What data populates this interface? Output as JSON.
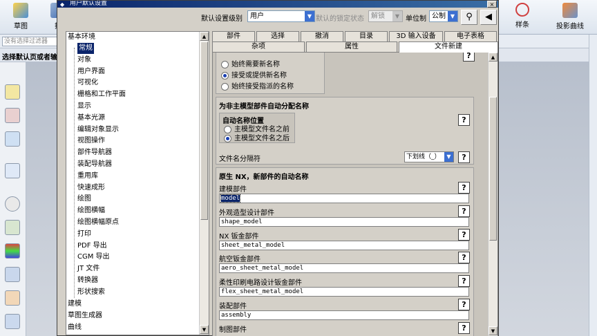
{
  "app": {
    "ribbon": {
      "sketch_label": "草图",
      "pull_label": "拉",
      "spline_label": "样条",
      "projected_curve_label": "投影曲线"
    },
    "filter_placeholder": "没有选择过滤器",
    "prompt": "选择默认页或者输"
  },
  "dialog": {
    "title": "用户默认设置",
    "close_glyph": "×",
    "topbar": {
      "level_label": "默认设置级别",
      "level_value": "用户",
      "lock_label": "默认的锁定状态",
      "lock_value": "解锁",
      "unit_label": "单位制",
      "unit_value": "公制"
    },
    "tree": {
      "root_basic": "基本环境",
      "items": [
        "常规",
        "对象",
        "用户界面",
        "可视化",
        "栅格和工作平面",
        "显示",
        "基本光源",
        "编辑对象显示",
        "视图操作",
        "部件导航器",
        "装配导航器",
        "重用库",
        "快速成形",
        "绘图",
        "绘图横幅",
        "绘图横幅原点",
        "打印",
        "PDF 导出",
        "CGM 导出",
        "JT 文件",
        "转换器",
        "形状搜索"
      ],
      "root_modeling": "建模",
      "root_sketch": "草图生成器",
      "root_curve": "曲线"
    },
    "tabs_row1": [
      "部件",
      "选择",
      "撤消",
      "目录",
      "3D 输入设备",
      "电子表格"
    ],
    "tabs_row2": [
      "杂项",
      "属性",
      "文件新建"
    ],
    "content": {
      "top_radios": [
        "始终需要新名称",
        "接受或提供新名称",
        "始终接受指派的名称"
      ],
      "section1_title": "为非主模型部件自动分配名称",
      "section1_sub": "自动名称位置",
      "section1_radios": [
        "主模型文件名之前",
        "主模型文件名之后"
      ],
      "separator_label": "文件名分隔符",
      "separator_value": "下划线（_）",
      "section2_title": "原生 NX，新部件的自动名称",
      "help_glyph": "?",
      "fields": [
        {
          "label": "建模部件",
          "value": "model"
        },
        {
          "label": "外观造型设计部件",
          "value": "shape_model"
        },
        {
          "label": "NX 钣金部件",
          "value": "sheet_metal_model"
        },
        {
          "label": "航空钣金部件",
          "value": "aero_sheet_metal_model"
        },
        {
          "label": "柔性印刷电路设计钣金部件",
          "value": "flex_sheet_metal_model"
        },
        {
          "label": "装配部件",
          "value": "assembly"
        },
        {
          "label": "制图部件",
          "value": ""
        }
      ]
    }
  }
}
